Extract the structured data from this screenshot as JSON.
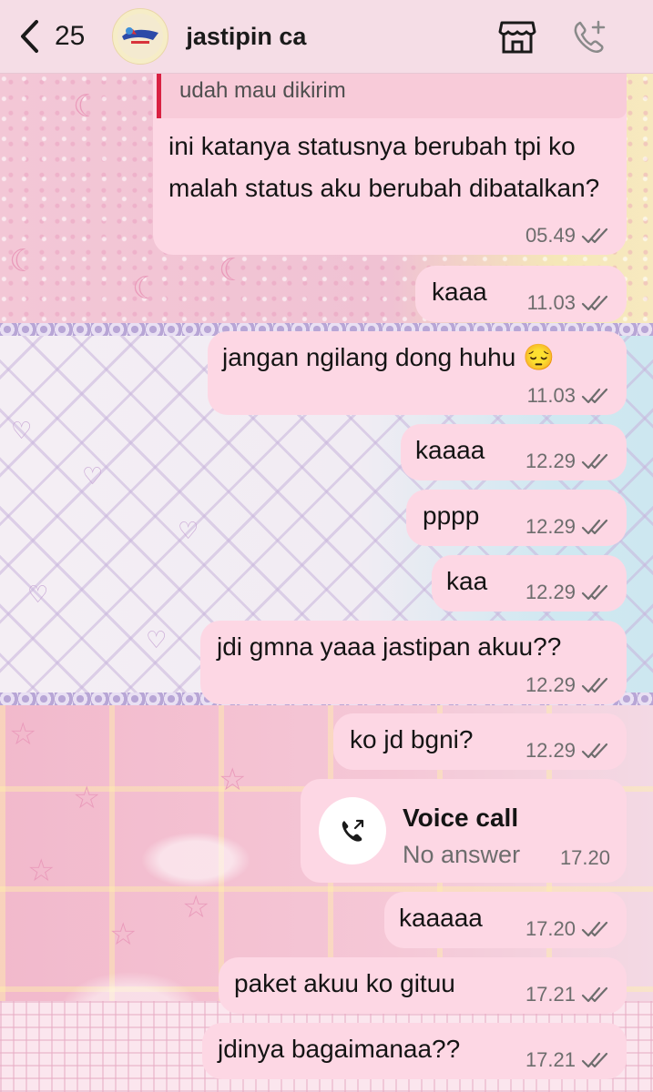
{
  "header": {
    "back_count": "25",
    "chat_name": "jastipin ca"
  },
  "reply_quote": {
    "text": "udah mau dikirim"
  },
  "messages": [
    {
      "text": "ini katanya statusnya berubah tpi ko malah status aku berubah dibatalkan?",
      "time": "05.49",
      "status": "read"
    },
    {
      "text": "kaaa",
      "time": "11.03",
      "status": "read"
    },
    {
      "text": "jangan ngilang dong huhu 😔",
      "time": "11.03",
      "status": "read"
    },
    {
      "text": "kaaaa",
      "time": "12.29",
      "status": "read"
    },
    {
      "text": "pppp",
      "time": "12.29",
      "status": "read"
    },
    {
      "text": "kaa",
      "time": "12.29",
      "status": "read"
    },
    {
      "text": "jdi gmna yaaa jastipan akuu??",
      "time": "12.29",
      "status": "read"
    },
    {
      "text": "ko jd bgni?",
      "time": "12.29",
      "status": "read"
    },
    {
      "text": "kaaaaa",
      "time": "17.20",
      "status": "read"
    },
    {
      "text": "paket akuu ko gituu",
      "time": "17.21",
      "status": "read"
    },
    {
      "text": "jdinya bagaimanaa??",
      "time": "17.21",
      "status": "read"
    }
  ],
  "voice_call": {
    "title": "Voice call",
    "subtitle": "No answer",
    "time": "17.20"
  },
  "colors": {
    "bubble": "#fdd7e4",
    "header": "#f5dde6",
    "reply_bar": "#d92142",
    "tick": "#6d6d6d"
  }
}
